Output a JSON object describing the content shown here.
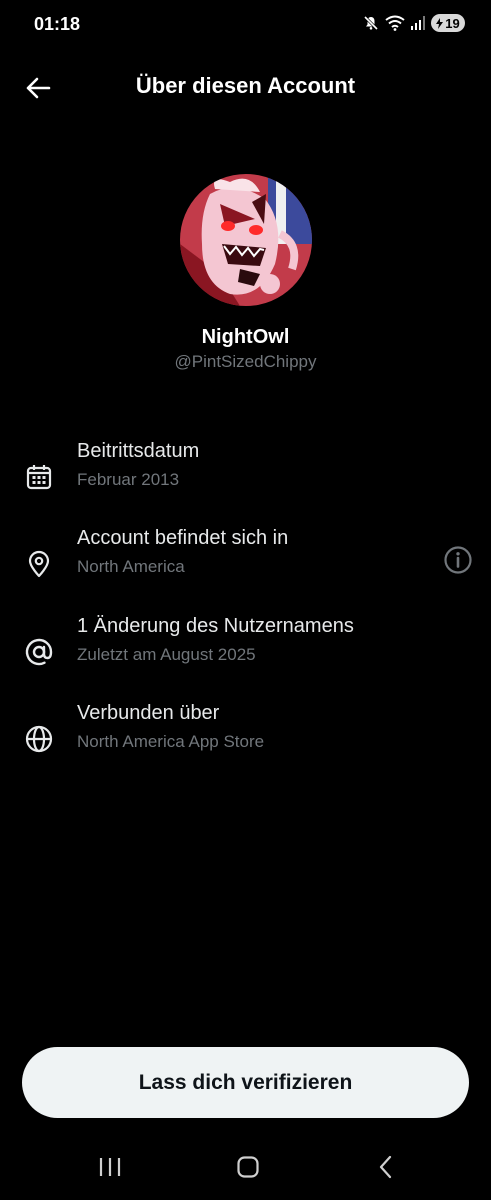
{
  "status_bar": {
    "time": "01:18",
    "battery_level": "19",
    "icons": [
      "mute-icon",
      "wifi-icon",
      "signal-icon",
      "battery-icon"
    ]
  },
  "header": {
    "title": "Über diesen Account",
    "back_icon": "arrow-left-icon"
  },
  "profile": {
    "display_name": "NightOwl",
    "handle": "@PintSizedChippy"
  },
  "info_items": [
    {
      "icon": "calendar-icon",
      "title": "Beitrittsdatum",
      "subtitle": "Februar 2013"
    },
    {
      "icon": "location-pin-icon",
      "title": "Account befindet sich in",
      "subtitle": "North America",
      "action_icon": "info-icon"
    },
    {
      "icon": "at-sign-icon",
      "title": "1 Änderung des Nutzernamens",
      "subtitle": "Zuletzt am August 2025"
    },
    {
      "icon": "globe-icon",
      "title": "Verbunden über",
      "subtitle": "North America App Store"
    }
  ],
  "verify_button": {
    "label": "Lass dich verifizieren"
  },
  "nav_bar": {
    "icons": [
      "recent-apps-icon",
      "home-icon",
      "back-icon"
    ]
  },
  "colors": {
    "background": "#000000",
    "primary_text": "#e7e9ea",
    "secondary_text": "#71767b",
    "button_bg": "#eff3f4",
    "button_text": "#0f1419"
  }
}
